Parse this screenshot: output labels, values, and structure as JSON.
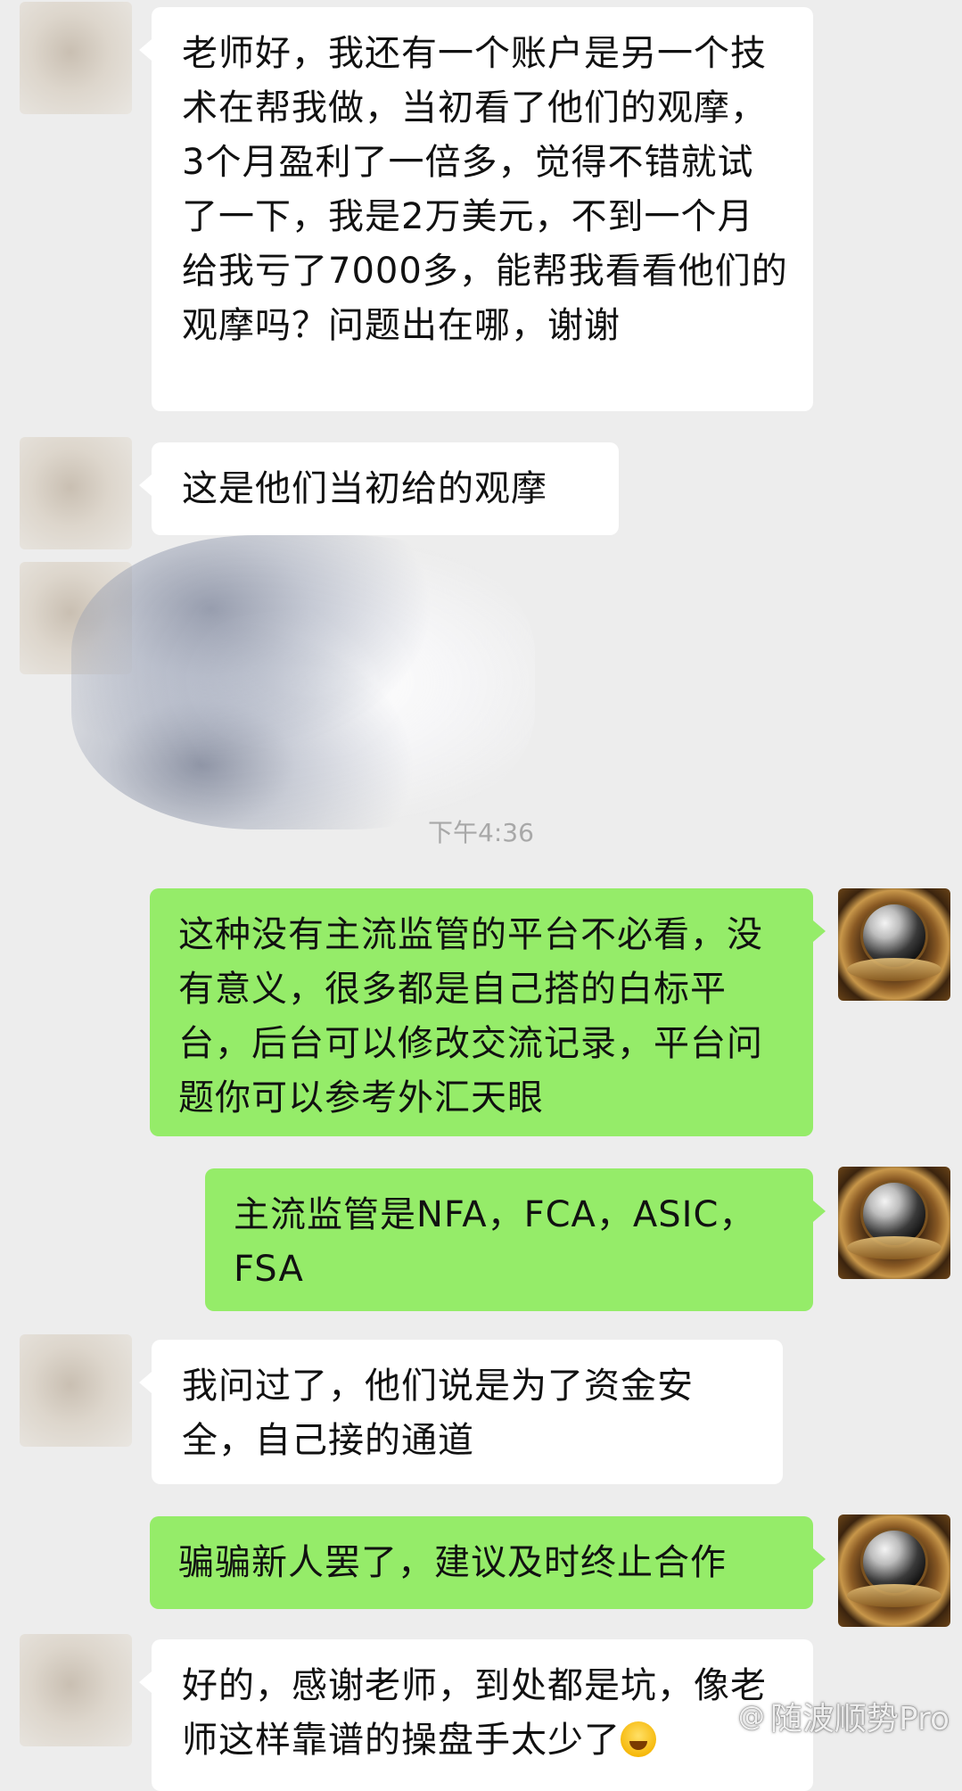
{
  "chat": {
    "timestamp": "下午4:36",
    "messages": [
      {
        "side": "left",
        "text": "老师好，我还有一个账户是另一个技术在帮我做，当初看了他们的观摩，3个月盈利了一倍多，觉得不错就试了一下，我是2万美元，不到一个月给我亏了7000多，能帮我看看他们的观摩吗？问题出在哪，谢谢"
      },
      {
        "side": "left",
        "text": "这是他们当初给的观摩"
      },
      {
        "side": "right",
        "text": "这种没有主流监管的平台不必看，没有意义，很多都是自己搭的白标平台，后台可以修改交流记录，平台问题你可以参考外汇天眼"
      },
      {
        "side": "right",
        "text": "主流监管是NFA，FCA，ASIC，FSA"
      },
      {
        "side": "left",
        "text": "我问过了，他们说是为了资金安全，自己接的通道"
      },
      {
        "side": "right",
        "text": "骗骗新人罢了，建议及时终止合作"
      },
      {
        "side": "left",
        "text": "好的，感谢老师，到处都是坑，像老师这样靠谱的操盘手太少了"
      }
    ]
  },
  "watermark": {
    "logo": "@",
    "text": "随波顺势Pro"
  },
  "icons": {
    "emoji": "crying-laughing-emoji",
    "avatar_right": "globe-avatar",
    "avatar_left": "blurred-avatar"
  }
}
